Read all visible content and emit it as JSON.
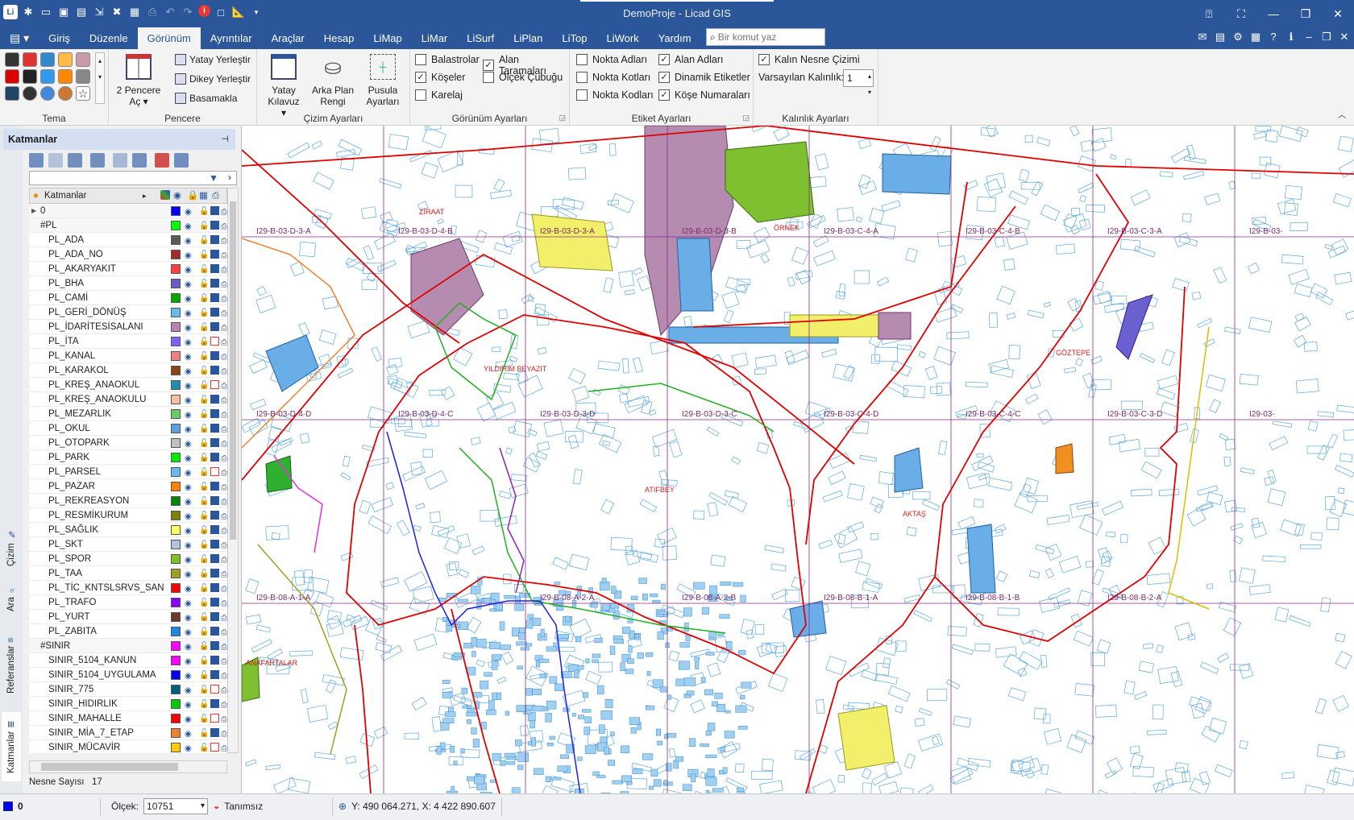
{
  "window": {
    "title": "DemoProje - Licad GIS"
  },
  "menu": {
    "file_icon": "file-menu-icon",
    "tabs": [
      "Giriş",
      "Düzenle",
      "Görünüm",
      "Ayrıntılar",
      "Araçlar",
      "Hesap",
      "LiMap",
      "LiMar",
      "LiSurf",
      "LiPlan",
      "LiTop",
      "LiWork",
      "Yardım"
    ],
    "active_tab": "Görünüm",
    "command_placeholder": "Bir komut yaz"
  },
  "ribbon": {
    "tema": {
      "label": "Tema"
    },
    "pencere": {
      "label": "Pencere",
      "big": "2 Pencere Aç",
      "yatay": "Yatay Yerleştir",
      "dikey": "Dikey Yerleştir",
      "basamakla": "Basamakla"
    },
    "cizim": {
      "label": "Çizim Ayarları",
      "yatay": "Yatay Kılavuz",
      "arka": "Arka Plan Rengi",
      "pusula": "Pusula Ayarları"
    },
    "gorunum": {
      "label": "Görünüm Ayarları",
      "balastrolar": "Balastrolar",
      "koseler": "Köşeler",
      "karelaj": "Karelaj",
      "alan_taramalari": "Alan Taramaları",
      "olcek_cubugu": "Ölçek Çubuğu"
    },
    "etiket": {
      "label": "Etiket Ayarları",
      "nokta_adlari": "Nokta Adları",
      "nokta_kotlari": "Nokta Kotları",
      "nokta_kodlari": "Nokta Kodları",
      "alan_adlari": "Alan Adları",
      "dinamik": "Dinamik Etiketler",
      "kose_numaralari": "Köşe Numaraları"
    },
    "kalinlik": {
      "label": "Kalınlık Ayarları",
      "kalin": "Kalın Nesne Çizimi",
      "varsayilan": "Varsayılan Kalınlık:",
      "value": "1"
    }
  },
  "panel": {
    "title": "Katmanlar",
    "header": "Katmanlar",
    "count_label": "Nesne Sayısı",
    "count_value": "17",
    "vtabs": [
      "Çizim",
      "Ara",
      "Referanslar",
      "Katmanlar"
    ],
    "layers": [
      {
        "name": "0",
        "color": "#0000ff",
        "group": true,
        "flag": true
      },
      {
        "name": "#PL",
        "color": "#00ff00",
        "group": true,
        "flag": true
      },
      {
        "name": "PL_ADA",
        "color": "#595959",
        "flag": true
      },
      {
        "name": "PL_ADA_NO",
        "color": "#a52a2a",
        "flag": true
      },
      {
        "name": "PL_AKARYAKIT",
        "color": "#ff4040",
        "flag": true
      },
      {
        "name": "PL_BHA",
        "color": "#6a5acd",
        "flag": true
      },
      {
        "name": "PL_CAMİ",
        "color": "#00aa00",
        "flag": true
      },
      {
        "name": "PL_GERİ_DÖNÜŞ",
        "color": "#66bbee",
        "flag": true
      },
      {
        "name": "PL_İDARİTESİSALANI",
        "color": "#c080b0",
        "flag": true
      },
      {
        "name": "PL_İTA",
        "color": "#8060ff",
        "flag": false
      },
      {
        "name": "PL_KANAL",
        "color": "#f08080",
        "flag": true
      },
      {
        "name": "PL_KARAKOL",
        "color": "#8b4513",
        "flag": true
      },
      {
        "name": "PL_KREŞ_ANAOKUL",
        "color": "#1e90b0",
        "flag": false
      },
      {
        "name": "PL_KREŞ_ANAOKULU",
        "color": "#f4c0a0",
        "flag": true
      },
      {
        "name": "PL_MEZARLIK",
        "color": "#66cc66",
        "flag": true
      },
      {
        "name": "PL_OKUL",
        "color": "#5aa0e0",
        "flag": true
      },
      {
        "name": "PL_OTOPARK",
        "color": "#c0c0c0",
        "flag": true
      },
      {
        "name": "PL_PARK",
        "color": "#00ee00",
        "flag": true
      },
      {
        "name": "PL_PARSEL",
        "color": "#66bbee",
        "flag": false
      },
      {
        "name": "PL_PAZAR",
        "color": "#ff8000",
        "flag": true
      },
      {
        "name": "PL_REKREASYON",
        "color": "#008800",
        "flag": true
      },
      {
        "name": "PL_RESMİKURUM",
        "color": "#808000",
        "flag": true
      },
      {
        "name": "PL_SAĞLIK",
        "color": "#ffff60",
        "flag": true
      },
      {
        "name": "PL_SKT",
        "color": "#b0c4de",
        "flag": true
      },
      {
        "name": "PL_SPOR",
        "color": "#80c020",
        "flag": true
      },
      {
        "name": "PL_TAA",
        "color": "#a0a020",
        "flag": true
      },
      {
        "name": "PL_TİC_KNTSLSRVS_SAN",
        "color": "#ff0000",
        "flag": true
      },
      {
        "name": "PL_TRAFO",
        "color": "#9000ff",
        "flag": true
      },
      {
        "name": "PL_YURT",
        "color": "#6b3a2a",
        "flag": true
      },
      {
        "name": "PL_ZABITA",
        "color": "#1e88e5",
        "flag": true
      },
      {
        "name": "#SINIR",
        "color": "#ff00ff",
        "group": true,
        "flag": true
      },
      {
        "name": "SINIR_5104_KANUN",
        "color": "#ff00ff",
        "flag": true
      },
      {
        "name": "SINIR_5104_UYGULAMA",
        "color": "#0000ff",
        "flag": true
      },
      {
        "name": "SINIR_775",
        "color": "#006080",
        "flag": false
      },
      {
        "name": "SINIR_HIDIRLIK",
        "color": "#00cc00",
        "flag": true
      },
      {
        "name": "SINIR_MAHALLE",
        "color": "#ff0000",
        "flag": false
      },
      {
        "name": "SINIR_MİA_7_ETAP",
        "color": "#f08030",
        "flag": true
      },
      {
        "name": "SINIR_MÜCAVİR",
        "color": "#ffcc00",
        "flag": false
      }
    ]
  },
  "map": {
    "sheets": [
      {
        "label": "I29-B-03-D-3-A",
        "col": 0,
        "row": 0
      },
      {
        "label": "I29-B-03-D-4-B",
        "col": 1,
        "row": 0
      },
      {
        "label": "I29-B-03-D-3-A",
        "col": 2,
        "row": 0
      },
      {
        "label": "I29-B-03-D-3-B",
        "col": 3,
        "row": 0
      },
      {
        "label": "I29-B-03-C-4-A",
        "col": 4,
        "row": 0
      },
      {
        "label": "I29-B-03-C-4-B",
        "col": 5,
        "row": 0
      },
      {
        "label": "I29-B-03-C-3-A",
        "col": 6,
        "row": 0
      },
      {
        "label": "I29-B-03-",
        "col": 7,
        "row": 0
      },
      {
        "label": "I29-B-03-D-4-D",
        "col": 0,
        "row": 1
      },
      {
        "label": "I29-B-03-D-4-C",
        "col": 1,
        "row": 1
      },
      {
        "label": "I29-B-03-D-3-D",
        "col": 2,
        "row": 1
      },
      {
        "label": "I29-B-03-D-3-C",
        "col": 3,
        "row": 1
      },
      {
        "label": "I29-B-03-C-4-D",
        "col": 4,
        "row": 1
      },
      {
        "label": "I29-B-03-C-4-C",
        "col": 5,
        "row": 1
      },
      {
        "label": "I29-B-03-C-3-D",
        "col": 6,
        "row": 1
      },
      {
        "label": "I29-03-",
        "col": 7,
        "row": 1
      },
      {
        "label": "I29-B-08-A-1-A",
        "col": 0,
        "row": 2
      },
      {
        "label": "I29-B-08-A-2-A",
        "col": 2,
        "row": 2
      },
      {
        "label": "I29-B-08-A-2-B",
        "col": 3,
        "row": 2
      },
      {
        "label": "I29-B-08-B-1-A",
        "col": 4,
        "row": 2
      },
      {
        "label": "I29-B-08-B-1-B",
        "col": 5,
        "row": 2
      },
      {
        "label": "I29-B-08-B-2-A",
        "col": 6,
        "row": 2
      }
    ],
    "places": [
      "ZİRAAT",
      "ÖRNEK",
      "YILDIRIM BEYAZIT",
      "ATIFBEY",
      "AKTAŞ",
      "ANAFARTALAR",
      "GÖZTEPE"
    ]
  },
  "status": {
    "layer": "0",
    "scale_label": "Ölçek:",
    "scale_value": "10751",
    "tanim": "Tanımsız",
    "coords": "Y: 490 064.271, X: 4 422 890.607"
  }
}
